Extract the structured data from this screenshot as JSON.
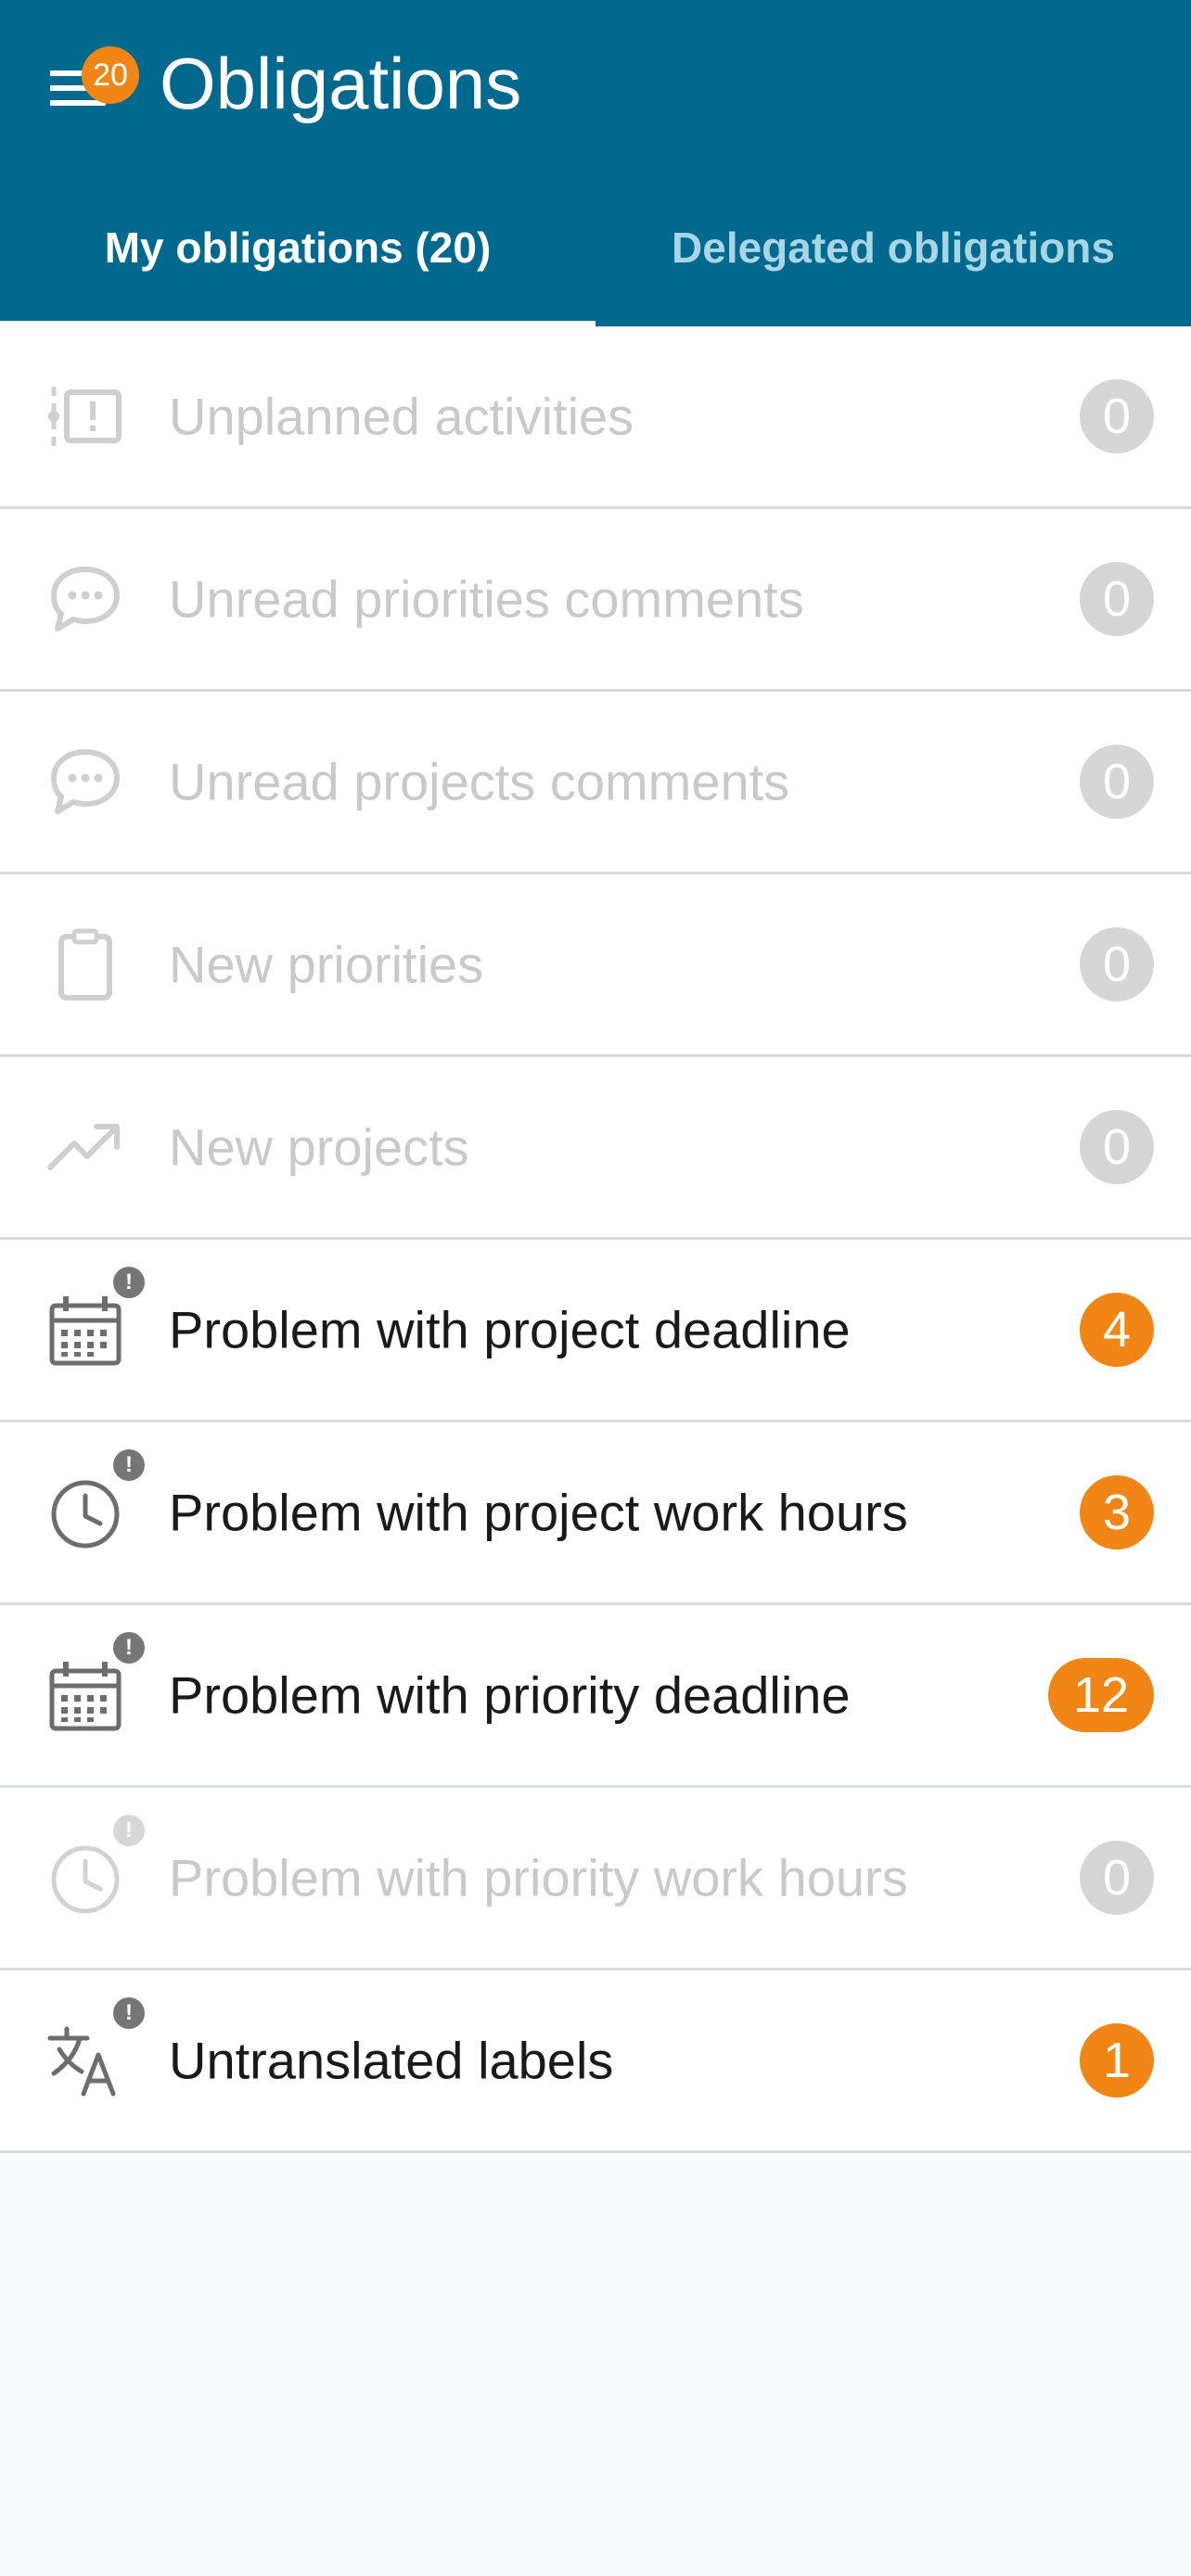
{
  "header": {
    "title": "Obligations",
    "menu_badge": "20"
  },
  "tabs": [
    {
      "label": "My obligations (20)",
      "active": true
    },
    {
      "label": "Delegated obligations",
      "active": false
    }
  ],
  "colors": {
    "primary": "#01698e",
    "accent": "#f18515",
    "disabled": "#c9c9c9"
  },
  "items": [
    {
      "icon": "unplanned-activity-icon",
      "label": "Unplanned activities",
      "count": "0",
      "alert": false
    },
    {
      "icon": "comment-bubble-icon",
      "label": "Unread priorities comments",
      "count": "0",
      "alert": false
    },
    {
      "icon": "comment-bubble-icon",
      "label": "Unread projects comments",
      "count": "0",
      "alert": false
    },
    {
      "icon": "clipboard-icon",
      "label": "New priorities",
      "count": "0",
      "alert": false
    },
    {
      "icon": "trending-up-icon",
      "label": "New projects",
      "count": "0",
      "alert": false
    },
    {
      "icon": "calendar-icon",
      "label": "Problem with project deadline",
      "count": "4",
      "alert": true
    },
    {
      "icon": "clock-icon",
      "label": "Problem with project work hours",
      "count": "3",
      "alert": true
    },
    {
      "icon": "calendar-icon",
      "label": "Problem with priority deadline",
      "count": "12",
      "alert": true
    },
    {
      "icon": "clock-icon",
      "label": "Problem with priority work hours",
      "count": "0",
      "alert": true
    },
    {
      "icon": "translate-icon",
      "label": "Untranslated labels",
      "count": "1",
      "alert": true
    }
  ]
}
